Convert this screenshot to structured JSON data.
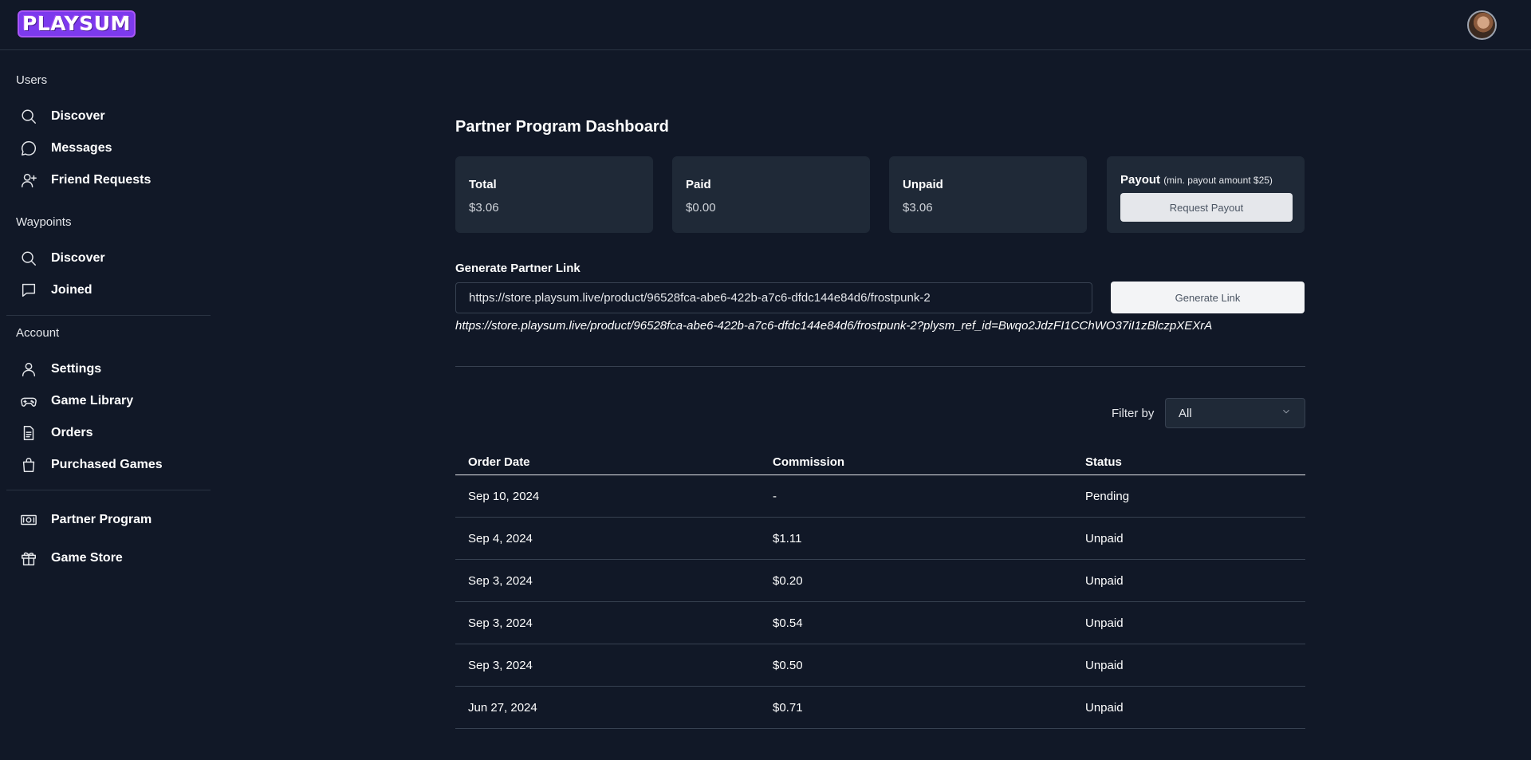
{
  "header": {
    "logo_text": "PLAYSUM"
  },
  "sidebar": {
    "sections": {
      "users": "Users",
      "waypoints": "Waypoints",
      "account": "Account"
    },
    "users_items": [
      {
        "label": "Discover",
        "icon": "search-icon"
      },
      {
        "label": "Messages",
        "icon": "chat-bubble-icon"
      },
      {
        "label": "Friend Requests",
        "icon": "user-plus-icon"
      }
    ],
    "waypoints_items": [
      {
        "label": "Discover",
        "icon": "search-icon"
      },
      {
        "label": "Joined",
        "icon": "message-square-icon"
      }
    ],
    "account_items": [
      {
        "label": "Settings",
        "icon": "user-icon"
      },
      {
        "label": "Game Library",
        "icon": "gamepad-icon"
      },
      {
        "label": "Orders",
        "icon": "document-icon"
      },
      {
        "label": "Purchased Games",
        "icon": "shopping-bag-icon"
      }
    ],
    "bottom_items": [
      {
        "label": "Partner Program",
        "icon": "money-icon"
      },
      {
        "label": "Game Store",
        "icon": "gift-icon"
      }
    ]
  },
  "main": {
    "title": "Partner Program Dashboard",
    "stats": [
      {
        "label": "Total",
        "value": "$3.06"
      },
      {
        "label": "Paid",
        "value": "$0.00"
      },
      {
        "label": "Unpaid",
        "value": "$3.06"
      }
    ],
    "payout": {
      "label": "Payout",
      "min_note": "(min. payout amount $25)",
      "button_label": "Request Payout"
    },
    "generate": {
      "label": "Generate Partner Link",
      "input_value": "https://store.playsum.live/product/96528fca-abe6-422b-a7c6-dfdc144e84d6/frostpunk-2",
      "button_label": "Generate Link",
      "result": "https://store.playsum.live/product/96528fca-abe6-422b-a7c6-dfdc144e84d6/frostpunk-2?plysm_ref_id=Bwqo2JdzFI1CChWO37iI1zBlczpXEXrA"
    },
    "filter": {
      "label": "Filter by",
      "selected": "All"
    },
    "table": {
      "headers": [
        "Order Date",
        "Commission",
        "Status"
      ],
      "rows": [
        [
          "Sep 10, 2024",
          "-",
          "Pending"
        ],
        [
          "Sep 4, 2024",
          "$1.11",
          "Unpaid"
        ],
        [
          "Sep 3, 2024",
          "$0.20",
          "Unpaid"
        ],
        [
          "Sep 3, 2024",
          "$0.54",
          "Unpaid"
        ],
        [
          "Sep 3, 2024",
          "$0.50",
          "Unpaid"
        ],
        [
          "Jun 27, 2024",
          "$0.71",
          "Unpaid"
        ]
      ]
    }
  }
}
